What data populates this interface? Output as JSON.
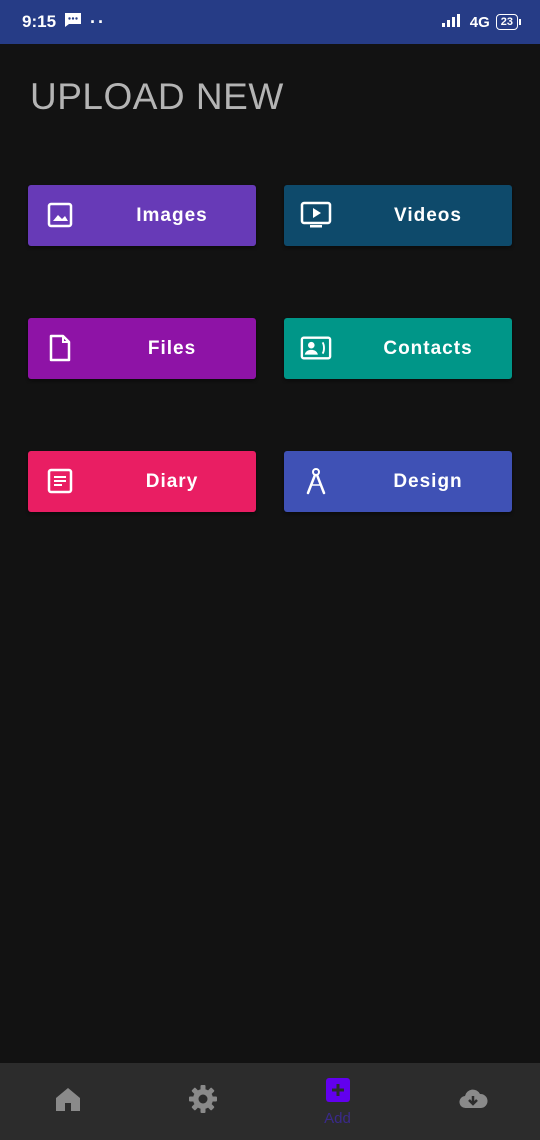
{
  "status_bar": {
    "time": "9:15",
    "network": "4G",
    "battery": "23",
    "icons": [
      "message-icon",
      "more-dots-icon",
      "signal-icon",
      "battery-icon"
    ]
  },
  "page": {
    "title": "UPLOAD NEW"
  },
  "tiles": [
    {
      "label": "Images",
      "icon": "image-icon",
      "color": "#673ab7"
    },
    {
      "label": "Videos",
      "icon": "video-icon",
      "color": "#0e4a6b"
    },
    {
      "label": "Files",
      "icon": "file-icon",
      "color": "#8e13a6"
    },
    {
      "label": "Contacts",
      "icon": "contact-card-icon",
      "color": "#009688"
    },
    {
      "label": "Diary",
      "icon": "diary-icon",
      "color": "#e91e63"
    },
    {
      "label": "Design",
      "icon": "compass-icon",
      "color": "#3f51b5"
    }
  ],
  "bottom_nav": {
    "items": [
      {
        "icon": "home-icon",
        "label": ""
      },
      {
        "icon": "settings-icon",
        "label": ""
      },
      {
        "icon": "add-icon",
        "label": "Add"
      },
      {
        "icon": "cloud-download-icon",
        "label": ""
      }
    ],
    "active_color": "#6200ee",
    "inactive_color": "#8a8a8a"
  }
}
